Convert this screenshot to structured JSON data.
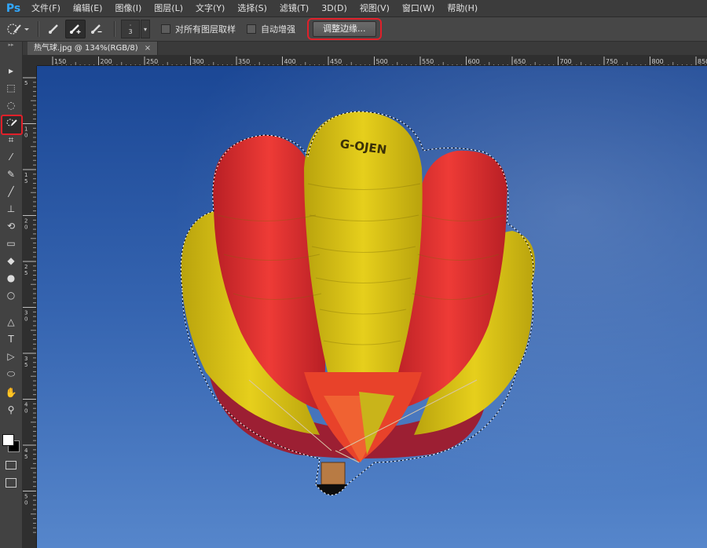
{
  "app": {
    "logo": "Ps"
  },
  "menu": [
    "文件(F)",
    "编辑(E)",
    "图像(I)",
    "图层(L)",
    "文字(Y)",
    "选择(S)",
    "滤镜(T)",
    "3D(D)",
    "视图(V)",
    "窗口(W)",
    "帮助(H)"
  ],
  "options": {
    "brush_size_top": "·",
    "brush_size_value": "3",
    "sample_all_layers": "对所有图层取样",
    "auto_enhance": "自动增强",
    "refine_edge": "调整边缘..."
  },
  "document": {
    "tab_title": "热气球.jpg @ 134%(RGB/8)",
    "close": "×"
  },
  "ruler": {
    "h_labels": [
      "150",
      "200",
      "250",
      "300",
      "350",
      "400",
      "450",
      "500",
      "550",
      "600",
      "650",
      "700",
      "750",
      "800",
      "850"
    ],
    "v_labels": [
      "5",
      "1 0",
      "1 5",
      "2 0",
      "2 5",
      "3 0",
      "3 5",
      "4 0",
      "4 5",
      "5 0"
    ]
  },
  "canvas": {
    "balloon_text": "G-OJEN"
  },
  "colors": {
    "sky_top": "#1d4a9c",
    "sky_bottom": "#4c7cc4",
    "balloon_red": "#e0312f",
    "balloon_yellow": "#d8c214",
    "highlight": "#e0202a"
  },
  "tools": [
    "move-tool",
    "marquee-tool",
    "lasso-tool",
    "quick-selection-tool",
    "crop-tool",
    "eyedropper-tool",
    "healing-brush-tool",
    "brush-tool",
    "clone-stamp-tool",
    "history-brush-tool",
    "eraser-tool",
    "paint-bucket-tool",
    "dodge-tool",
    "sponge-tool",
    "pen-tool",
    "type-tool",
    "path-selection-tool",
    "ellipse-tool",
    "hand-tool",
    "zoom-tool"
  ]
}
